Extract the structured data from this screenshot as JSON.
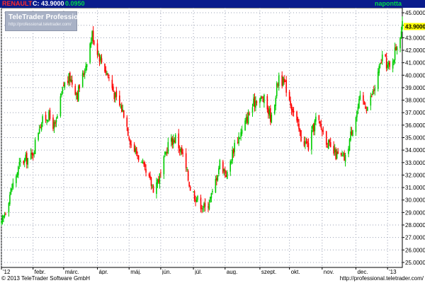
{
  "header": {
    "symbol": "RENAULT",
    "close_label": "C: 43.9000",
    "change": "0.0950",
    "period": "napontta"
  },
  "watermark": {
    "title": "TeleTrader Professional",
    "url": "http://professional.teletrader.com/"
  },
  "footer": {
    "copyright": "© 2013 TeleTrader Software GmbH",
    "url": "http://professional.teletrader.com/"
  },
  "colors": {
    "up": "#00cc00",
    "down": "#ff0000",
    "header_bg": "#0a1c8c",
    "last_price_bg": "#ffff00",
    "grid": "#9aa0b4"
  },
  "chart_data": {
    "type": "candlestick",
    "title": "",
    "last_price_label": "43.9000",
    "ylim": [
      24.6,
      45.4
    ],
    "y_ticks": [
      "25.0000",
      "26.0000",
      "27.0000",
      "28.0000",
      "29.0000",
      "30.0000",
      "31.0000",
      "32.0000",
      "33.0000",
      "34.0000",
      "35.0000",
      "36.0000",
      "37.0000",
      "38.0000",
      "39.0000",
      "40.0000",
      "41.0000",
      "42.0000",
      "43.0000",
      "44.0000",
      "45.0000"
    ],
    "x_ticks": [
      "'12",
      "febr.",
      "márc.",
      "ápr.",
      "máj.",
      "jún.",
      "júl.",
      "aug.",
      "szept.",
      "okt.",
      "nov.",
      "dec.",
      "'13"
    ],
    "x_tick_dates": [
      "2012-01-02",
      "2012-02-01",
      "2012-03-01",
      "2012-04-02",
      "2012-05-02",
      "2012-06-01",
      "2012-07-02",
      "2012-08-01",
      "2012-09-03",
      "2012-10-01",
      "2012-11-01",
      "2012-12-03",
      "2013-01-02"
    ],
    "date_range": [
      "2012-01-02",
      "2013-01-16"
    ],
    "close_path": [
      [
        "2012-01-02",
        28.0
      ],
      [
        "2012-01-10",
        30.5
      ],
      [
        "2012-01-20",
        33.0
      ],
      [
        "2012-01-31",
        33.5
      ],
      [
        "2012-02-07",
        36.0
      ],
      [
        "2012-02-15",
        36.8
      ],
      [
        "2012-02-22",
        35.8
      ],
      [
        "2012-03-01",
        39.2
      ],
      [
        "2012-03-07",
        39.8
      ],
      [
        "2012-03-14",
        38.5
      ],
      [
        "2012-03-21",
        40.5
      ],
      [
        "2012-03-28",
        43.3
      ],
      [
        "2012-04-04",
        41.5
      ],
      [
        "2012-04-12",
        40.0
      ],
      [
        "2012-04-20",
        38.0
      ],
      [
        "2012-04-27",
        37.0
      ],
      [
        "2012-05-04",
        34.5
      ],
      [
        "2012-05-11",
        33.5
      ],
      [
        "2012-05-18",
        32.0
      ],
      [
        "2012-05-25",
        31.0
      ],
      [
        "2012-06-01",
        32.0
      ],
      [
        "2012-06-08",
        34.5
      ],
      [
        "2012-06-15",
        35.0
      ],
      [
        "2012-06-22",
        33.5
      ],
      [
        "2012-06-29",
        31.0
      ],
      [
        "2012-07-06",
        30.0
      ],
      [
        "2012-07-13",
        29.3
      ],
      [
        "2012-07-20",
        30.5
      ],
      [
        "2012-07-27",
        33.0
      ],
      [
        "2012-08-03",
        32.0
      ],
      [
        "2012-08-10",
        34.5
      ],
      [
        "2012-08-17",
        35.5
      ],
      [
        "2012-08-24",
        37.0
      ],
      [
        "2012-08-31",
        38.2
      ],
      [
        "2012-09-07",
        38.0
      ],
      [
        "2012-09-14",
        36.5
      ],
      [
        "2012-09-21",
        40.0
      ],
      [
        "2012-09-28",
        39.0
      ],
      [
        "2012-10-05",
        37.0
      ],
      [
        "2012-10-12",
        35.0
      ],
      [
        "2012-10-19",
        34.3
      ],
      [
        "2012-10-26",
        36.5
      ],
      [
        "2012-11-02",
        35.5
      ],
      [
        "2012-11-09",
        34.0
      ],
      [
        "2012-11-16",
        33.5
      ],
      [
        "2012-11-23",
        33.3
      ],
      [
        "2012-11-30",
        36.0
      ],
      [
        "2012-12-07",
        38.0
      ],
      [
        "2012-12-14",
        37.5
      ],
      [
        "2012-12-21",
        39.0
      ],
      [
        "2012-12-28",
        41.5
      ],
      [
        "2013-01-04",
        40.5
      ],
      [
        "2013-01-11",
        42.5
      ],
      [
        "2013-01-16",
        43.9
      ]
    ],
    "grid": true,
    "y_axis_side": "right"
  }
}
